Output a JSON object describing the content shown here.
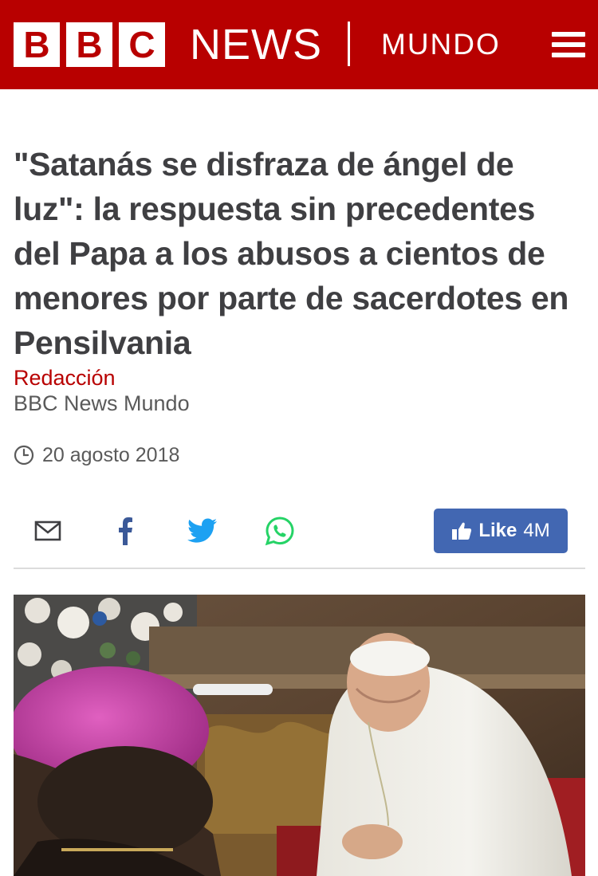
{
  "header": {
    "logo_letters": [
      "B",
      "B",
      "C"
    ],
    "news_word": "NEWS",
    "section": "MUNDO",
    "menu_icon": "hamburger-menu-icon",
    "background_color": "#b80000"
  },
  "article": {
    "headline": "\"Satanás se disfraza de ángel de luz\": la respuesta sin precedentes del Papa a los abusos a cientos de menores por parte de sacerdotes en Pensilvania",
    "byline_name": "Redacción",
    "byline_org": "BBC News Mundo",
    "date_icon": "clock-icon",
    "date": "20 agosto 2018"
  },
  "share": {
    "icons": [
      "email-icon",
      "facebook-icon",
      "twitter-icon",
      "whatsapp-icon"
    ],
    "like_label": "Like",
    "like_count": "4M",
    "like_color": "#4267b2",
    "facebook_color": "#3b5998",
    "twitter_color": "#1da1f2",
    "whatsapp_color": "#25d366"
  }
}
